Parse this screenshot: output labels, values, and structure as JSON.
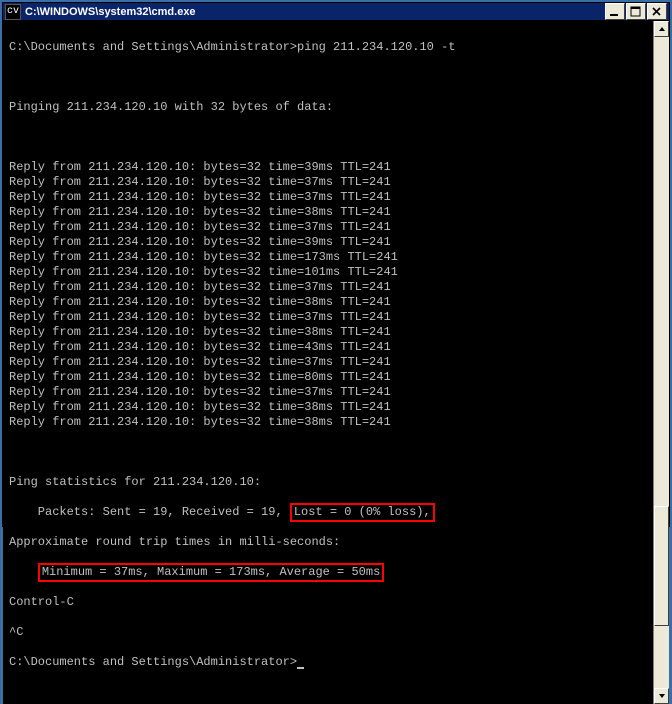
{
  "window": {
    "title": "C:\\WINDOWS\\system32\\cmd.exe",
    "icon_label": "cv"
  },
  "prompt1": "C:\\Documents and Settings\\Administrator>",
  "command": "ping 211.234.120.10 -t",
  "ping_header": "Pinging 211.234.120.10 with 32 bytes of data:",
  "replies": [
    "Reply from 211.234.120.10: bytes=32 time=39ms TTL=241",
    "Reply from 211.234.120.10: bytes=32 time=37ms TTL=241",
    "Reply from 211.234.120.10: bytes=32 time=37ms TTL=241",
    "Reply from 211.234.120.10: bytes=32 time=38ms TTL=241",
    "Reply from 211.234.120.10: bytes=32 time=37ms TTL=241",
    "Reply from 211.234.120.10: bytes=32 time=39ms TTL=241",
    "Reply from 211.234.120.10: bytes=32 time=173ms TTL=241",
    "Reply from 211.234.120.10: bytes=32 time=101ms TTL=241",
    "Reply from 211.234.120.10: bytes=32 time=37ms TTL=241",
    "Reply from 211.234.120.10: bytes=32 time=38ms TTL=241",
    "Reply from 211.234.120.10: bytes=32 time=37ms TTL=241",
    "Reply from 211.234.120.10: bytes=32 time=38ms TTL=241",
    "Reply from 211.234.120.10: bytes=32 time=43ms TTL=241",
    "Reply from 211.234.120.10: bytes=32 time=37ms TTL=241",
    "Reply from 211.234.120.10: bytes=32 time=80ms TTL=241",
    "Reply from 211.234.120.10: bytes=32 time=37ms TTL=241",
    "Reply from 211.234.120.10: bytes=32 time=38ms TTL=241",
    "Reply from 211.234.120.10: bytes=32 time=38ms TTL=241"
  ],
  "stats_header": "Ping statistics for 211.234.120.10:",
  "packets_prefix": "    Packets: Sent = 19, Received = 19, ",
  "packets_lost": "Lost = 0 (0% loss),",
  "approx_line": "Approximate round trip times in milli-seconds:",
  "minmax_prefix": "    ",
  "minmax": "Minimum = 37ms, Maximum = 173ms, Average = 50ms",
  "ctrl_c": "Control-C",
  "caret_c": "^C",
  "prompt2": "C:\\Documents and Settings\\Administrator>"
}
